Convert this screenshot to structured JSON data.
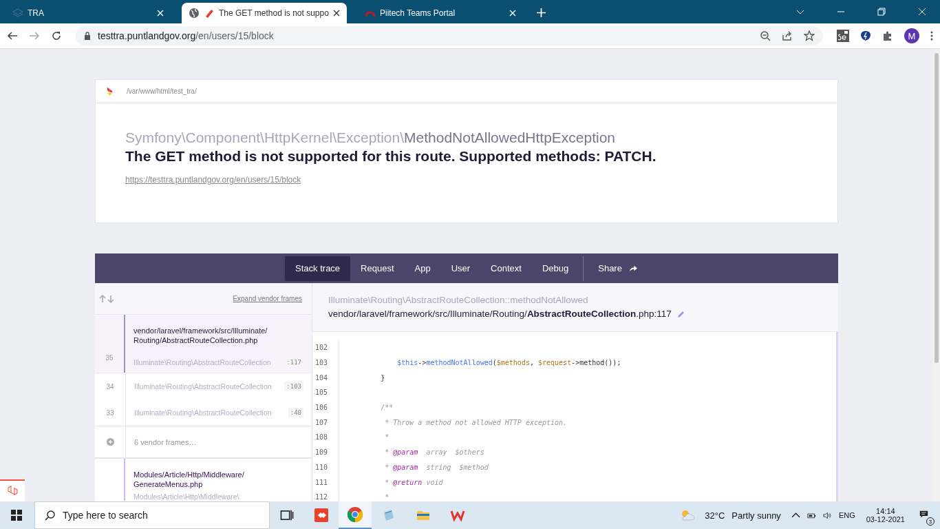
{
  "browser": {
    "tabs": [
      {
        "title": "TRA",
        "selected": false
      },
      {
        "title": "The GET method is not suppo",
        "selected": true
      },
      {
        "title": "Piitech Teams Portal",
        "selected": false
      }
    ],
    "address": {
      "host": "testtra.puntlandgov.org",
      "path": "/en/users/15/block"
    },
    "profile_initial": "M"
  },
  "error_page": {
    "app_path": "/var/www/html/test_tra/",
    "exception": {
      "namespace": "Symfony\\Component\\HttpKernel\\Exception\\",
      "class": "MethodNotAllowedHttpException"
    },
    "message": "The GET method is not supported for this route. Supported methods: PATCH.",
    "url": "https://testtra.puntlandgov.org/en/users/15/block",
    "tabs": [
      {
        "label": "Stack trace",
        "selected": true
      },
      {
        "label": "Request",
        "selected": false
      },
      {
        "label": "App",
        "selected": false
      },
      {
        "label": "User",
        "selected": false
      },
      {
        "label": "Context",
        "selected": false
      },
      {
        "label": "Debug",
        "selected": false
      }
    ],
    "share": "Share",
    "expand_vendor": "Expand vendor frames",
    "frames": [
      {
        "kind": "frame",
        "number": "35",
        "file_lines": [
          "vendor/laravel/framework/src/Illuminate/",
          "Routing/AbstractRouteCollection.php"
        ],
        "class": "Illuminate\\Routing\\AbstractRouteCollection",
        "line": ":117",
        "selected": true,
        "app": false
      },
      {
        "kind": "frame",
        "number": "34",
        "class": "Illuminate\\Routing\\AbstractRouteCollection",
        "line": ":103",
        "selected": false,
        "app": false
      },
      {
        "kind": "frame",
        "number": "33",
        "class": "Illuminate\\Routing\\AbstractRouteCollection",
        "line": ":40",
        "selected": false,
        "app": false
      },
      {
        "kind": "vendor_group",
        "label": "6 vendor frames…"
      },
      {
        "kind": "frame",
        "file_lines": [
          "Modules/Article/Http/Middleware/",
          "GenerateMenus.php"
        ],
        "class": "Modules\\Article\\Http\\Middleware\\",
        "selected": false,
        "app": true
      }
    ],
    "method": "Illuminate\\Routing\\AbstractRouteCollection::methodNotAllowed",
    "file": "vendor/laravel/framework/src/Illuminate/Routing/**AbstractRouteCollection**.php:117",
    "code": [
      {
        "number": "102"
      },
      {
        "number": "103",
        "tokens": [
          {
            "t": "            $this",
            "kind": "keyword"
          },
          {
            "t": "->",
            "kind": "plain"
          },
          {
            "t": "methodNotAllowed",
            "kind": "function"
          },
          {
            "t": "(",
            "kind": "plain"
          },
          {
            "t": "$methods",
            "kind": "variable"
          },
          {
            "t": ", ",
            "kind": "plain"
          },
          {
            "t": "$request",
            "kind": "variable"
          },
          {
            "t": "->method());",
            "kind": "plain"
          }
        ]
      },
      {
        "number": "104",
        "tokens": [
          {
            "t": "        }",
            "kind": "plain"
          }
        ]
      },
      {
        "number": "105"
      },
      {
        "number": "106",
        "tokens": [
          {
            "t": "        /**",
            "kind": "comment"
          }
        ]
      },
      {
        "number": "107",
        "tokens": [
          {
            "t": "         * Throw a method not allowed HTTP exception.",
            "kind": "comment"
          }
        ]
      },
      {
        "number": "108",
        "tokens": [
          {
            "t": "         *",
            "kind": "comment"
          }
        ]
      },
      {
        "number": "109",
        "tokens": [
          {
            "t": "         * ",
            "kind": "comment"
          },
          {
            "t": "@param",
            "kind": "tag"
          },
          {
            "t": "  array  $others",
            "kind": "comment"
          }
        ]
      },
      {
        "number": "110",
        "tokens": [
          {
            "t": "         * ",
            "kind": "comment"
          },
          {
            "t": "@param",
            "kind": "tag"
          },
          {
            "t": "  string  $method",
            "kind": "comment"
          }
        ]
      },
      {
        "number": "111",
        "tokens": [
          {
            "t": "         * ",
            "kind": "comment"
          },
          {
            "t": "@return",
            "kind": "tag"
          },
          {
            "t": " void",
            "kind": "comment"
          }
        ]
      },
      {
        "number": "112",
        "tokens": [
          {
            "t": "         *",
            "kind": "comment"
          }
        ]
      }
    ]
  },
  "taskbar": {
    "search_placeholder": "Type here to search",
    "temperature": "32°C",
    "weather": "Partly sunny",
    "language": "ENG",
    "time": "14:14",
    "date": "03-12-2021",
    "notifications": "3"
  }
}
